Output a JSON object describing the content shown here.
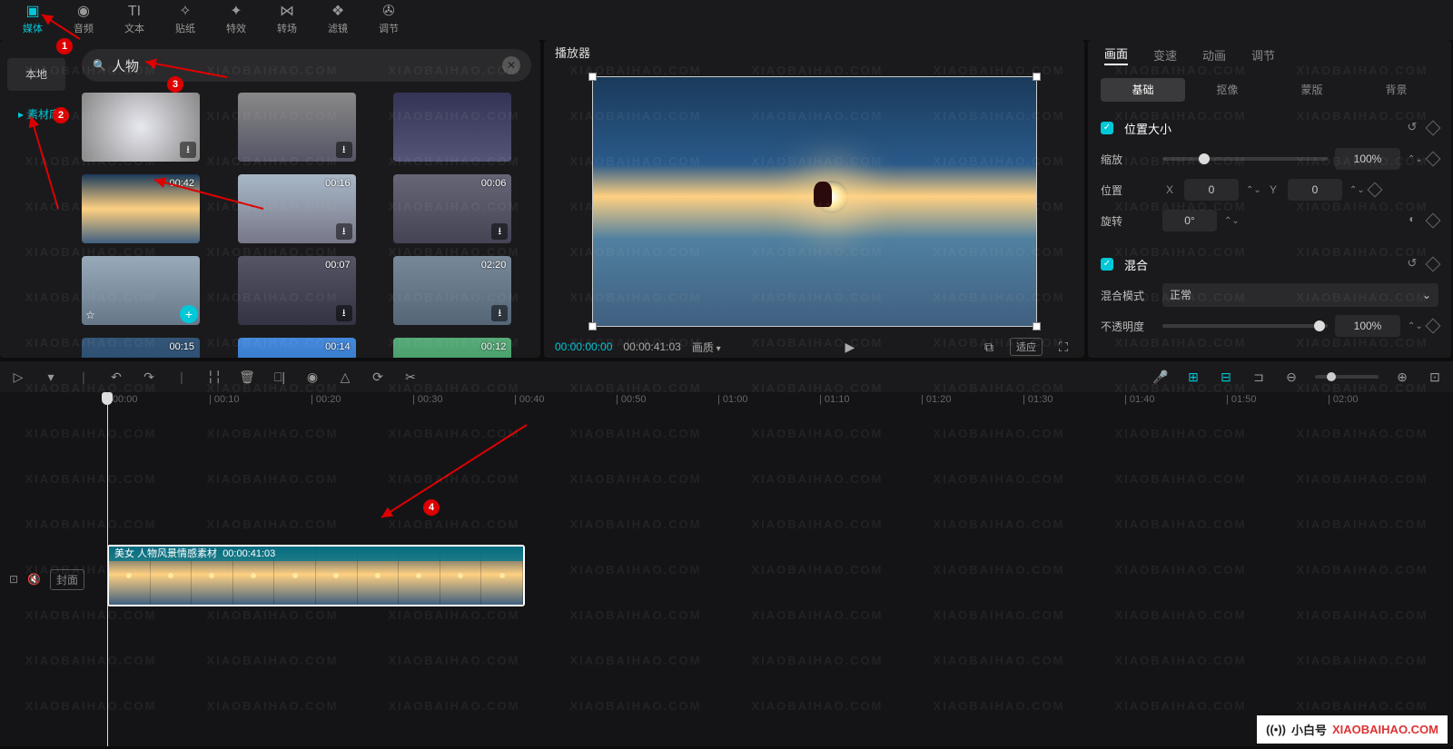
{
  "top_tabs": {
    "media": {
      "label": "媒体",
      "icon": "▣"
    },
    "audio": {
      "label": "音频",
      "icon": "◉"
    },
    "text": {
      "label": "文本",
      "icon": "TI"
    },
    "sticker": {
      "label": "贴纸",
      "icon": "✧"
    },
    "effect": {
      "label": "特效",
      "icon": "✦"
    },
    "trans": {
      "label": "转场",
      "icon": "⋈"
    },
    "filter": {
      "label": "滤镜",
      "icon": "❖"
    },
    "adjust": {
      "label": "调节",
      "icon": "✇"
    }
  },
  "sidebar": {
    "local": "本地",
    "library": "素材库"
  },
  "search": {
    "placeholder": "",
    "value": "人物",
    "icon": "🔍"
  },
  "thumbs": [
    {
      "dur": "",
      "dl": true,
      "cls": "t1"
    },
    {
      "dur": "",
      "dl": true,
      "cls": "t2"
    },
    {
      "dur": "",
      "dl": false,
      "cls": "t3"
    },
    {
      "dur": "00:42",
      "dl": false,
      "cls": "t4"
    },
    {
      "dur": "00:16",
      "dl": true,
      "cls": "t5"
    },
    {
      "dur": "00:06",
      "dl": true,
      "cls": "t6"
    },
    {
      "dur": "",
      "dl": false,
      "cls": "t7",
      "fav": true,
      "add": true
    },
    {
      "dur": "00:07",
      "dl": true,
      "cls": "t8"
    },
    {
      "dur": "02:20",
      "dl": true,
      "cls": "t9"
    },
    {
      "dur": "00:15",
      "dl": false,
      "cls": "t10"
    },
    {
      "dur": "00:14",
      "dl": false,
      "cls": "t11"
    },
    {
      "dur": "00:12",
      "dl": false,
      "cls": "t12"
    }
  ],
  "player": {
    "title": "播放器",
    "tc_current": "00:00:00:00",
    "tc_total": "00:00:41:03",
    "quality": "画质",
    "ratio_btn": "适应"
  },
  "inspector": {
    "tabs": {
      "picture": "画面",
      "speed": "变速",
      "anim": "动画",
      "adj": "调节"
    },
    "subtabs": {
      "basic": "基础",
      "cutout": "抠像",
      "mask": "蒙版",
      "bg": "背景"
    },
    "pos_size_label": "位置大小",
    "scale_label": "缩放",
    "scale_value": "100%",
    "pos_label": "位置",
    "x_label": "X",
    "x_value": "0",
    "y_label": "Y",
    "y_value": "0",
    "rot_label": "旋转",
    "rot_value": "0°",
    "blend_header": "混合",
    "blend_mode_label": "混合模式",
    "blend_mode_value": "正常",
    "opacity_label": "不透明度",
    "opacity_value": "100%"
  },
  "timeline": {
    "ticks": [
      "00:00",
      "00:10",
      "00:20",
      "00:30",
      "00:40",
      "00:50",
      "01:00",
      "01:10",
      "01:20",
      "01:30",
      "01:40",
      "01:50",
      "02:00"
    ],
    "cover": "封面",
    "clip_title": "美女 人物风景情感素材",
    "clip_dur": "00:00:41:03"
  },
  "watermark": "XIAOBAIHAO.COM",
  "badge": {
    "text": "小白号",
    "url": "XIAOBAIHAO.COM"
  }
}
